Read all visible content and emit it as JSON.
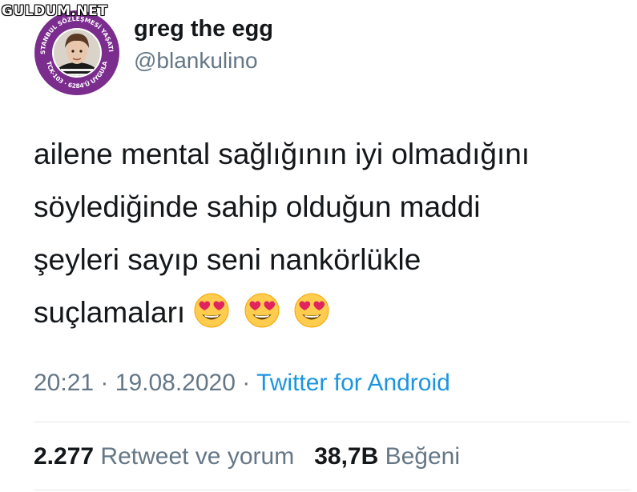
{
  "watermark": "GULDUM.NET",
  "user": {
    "name": "greg the egg",
    "handle": "@blankulino",
    "avatar_badge_text": "İSTANBUL SÖZLEŞMESİ YAŞATIR · TCK-103 · 6284'Ü UYGULA"
  },
  "tweet": {
    "lines": [
      "ailene mental sağlığının iyi olmadığını",
      "söylediğinde sahip olduğun maddi",
      "şeyleri sayıp seni nankörlükle",
      "suçlamaları"
    ],
    "emojis": [
      "heart-eyes-emoji",
      "heart-eyes-emoji",
      "heart-eyes-emoji"
    ]
  },
  "meta": {
    "time": "20:21",
    "date": "19.08.2020",
    "separator": "·",
    "source": "Twitter for Android"
  },
  "stats": {
    "retweets_count": "2.277",
    "retweets_label": "Retweet ve yorum",
    "likes_count": "38,7B",
    "likes_label": "Beğeni"
  },
  "colors": {
    "text": "#14171a",
    "secondary": "#657786",
    "link": "#1b95e0",
    "badge_ring": "#7b2d8e"
  }
}
